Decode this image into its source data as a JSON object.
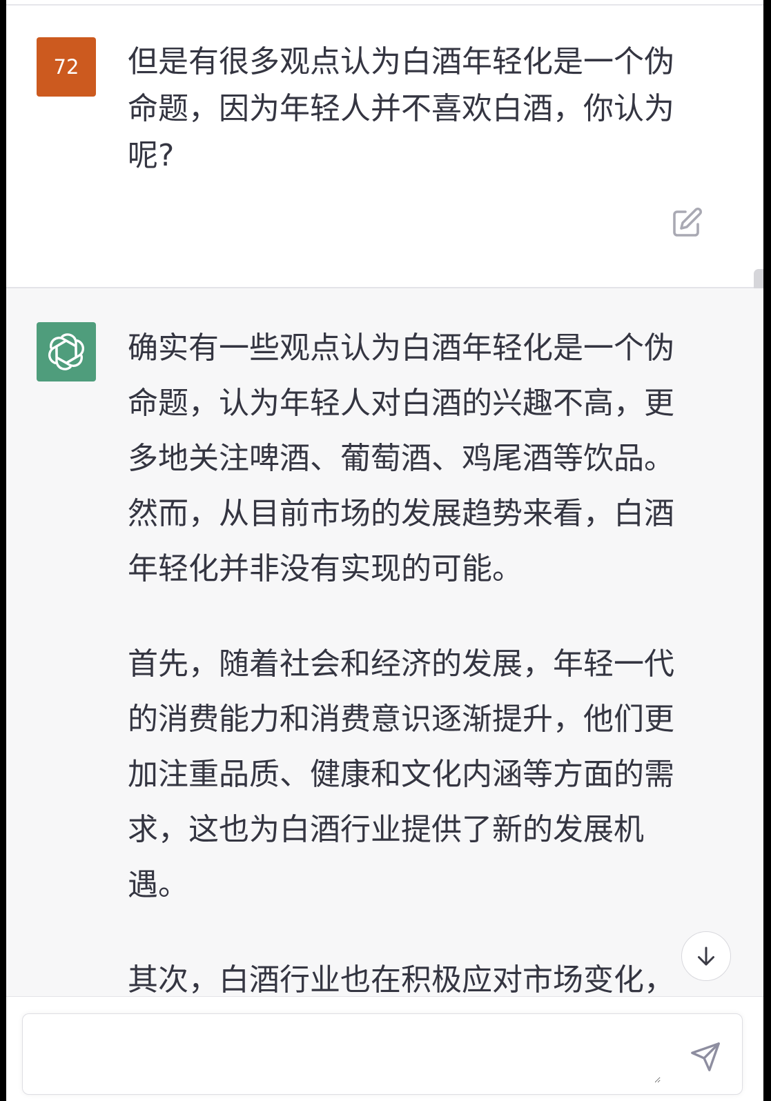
{
  "user_message": {
    "avatar_label": "72",
    "avatar_color": "#cc5a1f",
    "text": "但是有很多观点认为白酒年轻化是一个伪命题，因为年轻人并不喜欢白酒，你认为呢?",
    "edit_icon": "edit-icon"
  },
  "assistant_message": {
    "avatar_icon": "openai-logo-icon",
    "avatar_color": "#4f9d7c",
    "paragraphs": [
      "确实有一些观点认为白酒年轻化是一个伪命题，认为年轻人对白酒的兴趣不高，更多地关注啤酒、葡萄酒、鸡尾酒等饮品。然而，从目前市场的发展趋势来看，白酒年轻化并非没有实现的可能。",
      "首先，随着社会和经济的发展，年轻一代的消费能力和消费意识逐渐提升，他们更加注重品质、健康和文化内涵等方面的需求，这也为白酒行业提供了新的发展机遇。",
      "其次，白酒行业也在积极应对市场变化，"
    ]
  },
  "scroll_down_icon": "arrow-down-icon",
  "composer": {
    "value": "",
    "send_icon": "send-icon"
  }
}
